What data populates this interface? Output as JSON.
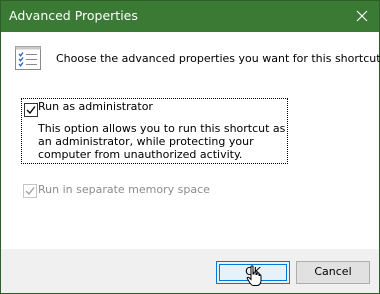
{
  "window": {
    "title": "Advanced Properties",
    "accent_color": "#3a7a35"
  },
  "header": {
    "icon": "property-list-icon",
    "intro_text": "Choose the advanced properties you want for this shortcut."
  },
  "options": {
    "run_as_admin": {
      "label": "Run as administrator",
      "checked": true,
      "description": "This option allows you to run this shortcut as an administrator, while protecting your computer from unauthorized activity."
    },
    "separate_memory": {
      "label": "Run in separate memory space",
      "checked": true,
      "disabled": true
    }
  },
  "buttons": {
    "ok_label": "OK",
    "cancel_label": "Cancel"
  }
}
